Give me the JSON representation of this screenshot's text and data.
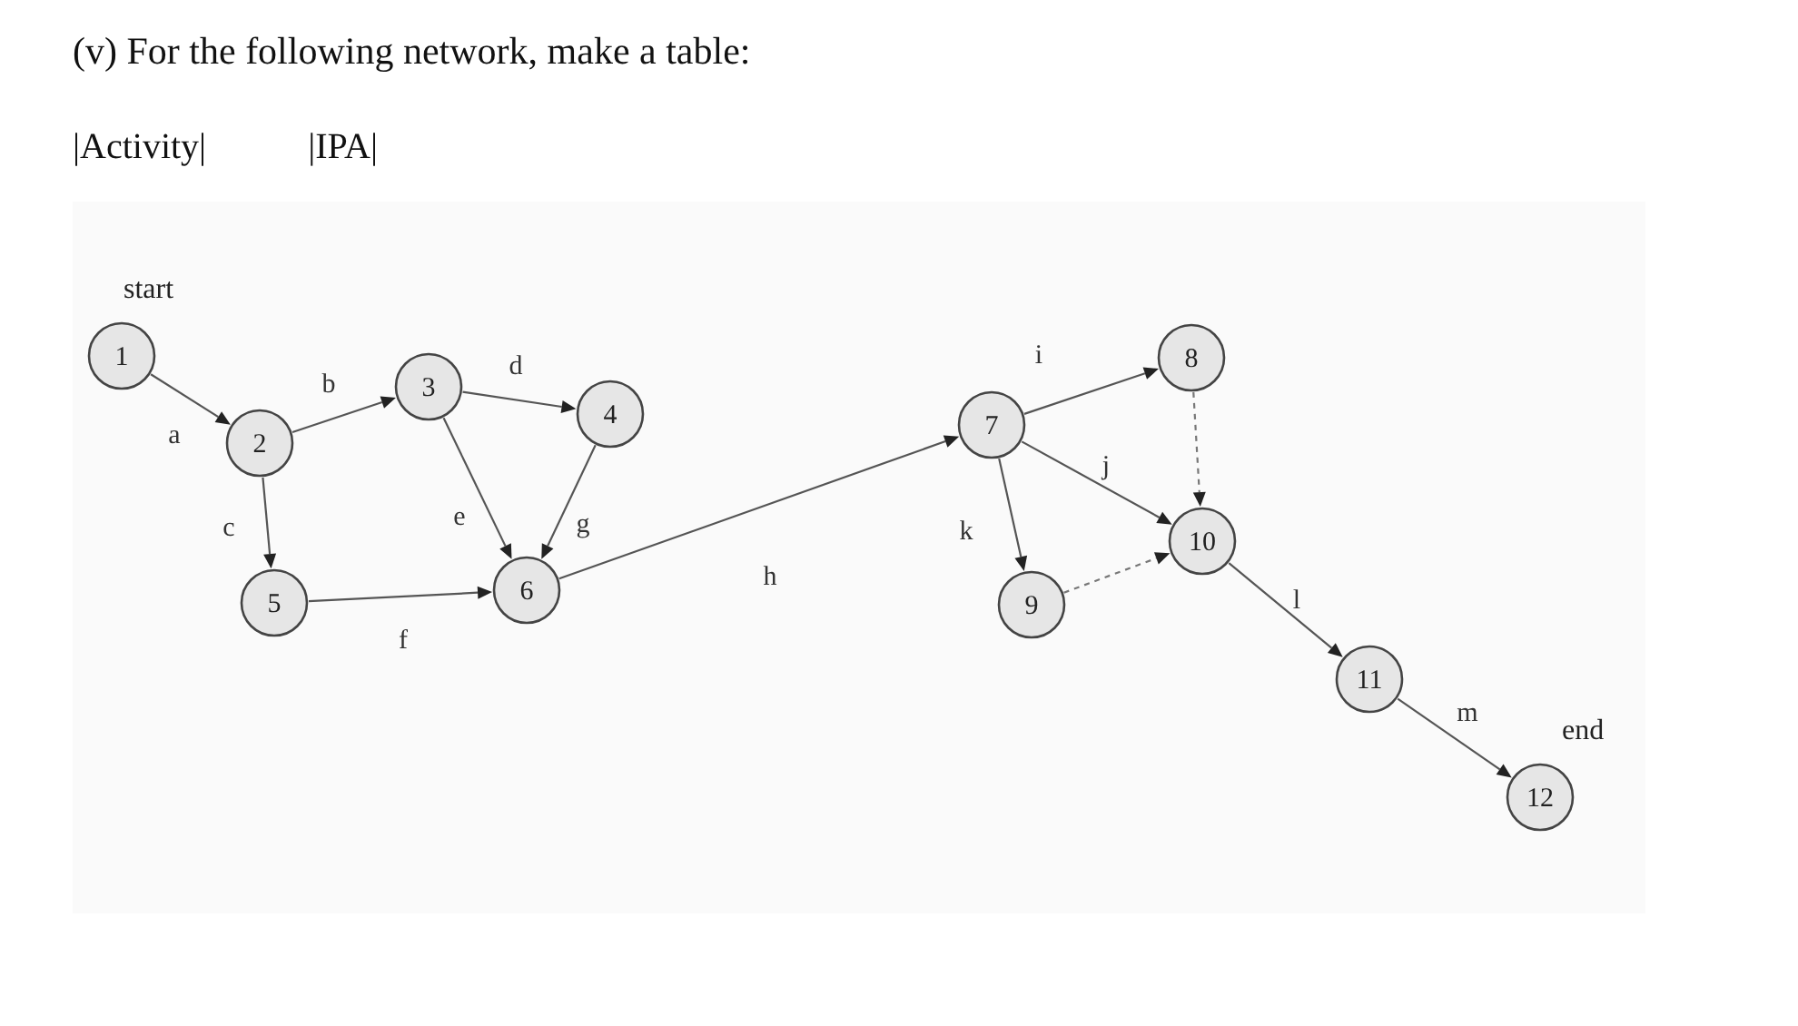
{
  "question": "(v) For the following network, make a table:",
  "table_headers": [
    "|Activity|",
    "|IPA|"
  ],
  "diagram": {
    "start_label": "start",
    "end_label": "end",
    "nodes": [
      "1",
      "2",
      "3",
      "4",
      "5",
      "6",
      "7",
      "8",
      "9",
      "10",
      "11",
      "12"
    ],
    "edges": [
      {
        "label": "a",
        "kind": "activity"
      },
      {
        "label": "b",
        "kind": "activity"
      },
      {
        "label": "c",
        "kind": "activity"
      },
      {
        "label": "d",
        "kind": "activity"
      },
      {
        "label": "e",
        "kind": "activity"
      },
      {
        "label": "g",
        "kind": "activity"
      },
      {
        "label": "f",
        "kind": "activity"
      },
      {
        "label": "h",
        "kind": "activity"
      },
      {
        "label": "i",
        "kind": "activity"
      },
      {
        "label": "j",
        "kind": "activity"
      },
      {
        "label": "k",
        "kind": "activity"
      },
      {
        "label": "l",
        "kind": "activity"
      },
      {
        "label": "m",
        "kind": "activity"
      },
      {
        "kind": "dummy"
      },
      {
        "kind": "dummy"
      }
    ]
  }
}
